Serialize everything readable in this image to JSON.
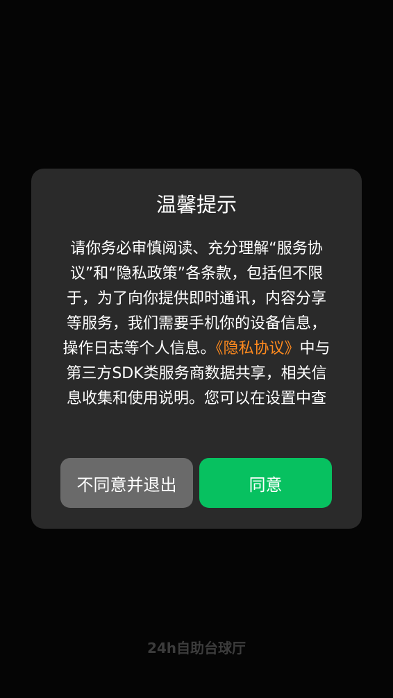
{
  "dialog": {
    "title": "温馨提示",
    "body_before_link": "请你务必审慎阅读、充分理解“服务协议”和“隐私政策”各条款，包括但不限于，为了向你提供即时通讯，内容分享等服务，我们需要手机你的设备信息，操作日志等个人信息。",
    "body_link": "《隐私协议》",
    "body_after_link": "中与第三方SDK类服务商数据共享，相关信息收集和使用说明。您可以在设置中查",
    "decline_label": "不同意并退出",
    "agree_label": "同意"
  },
  "footer": {
    "brand": "24h自助台球厅"
  },
  "colors": {
    "background": "#050505",
    "dialog": "#2a2a2a",
    "link": "#ff8a1e",
    "decline_button": "#6a6a6a",
    "agree_button": "#07c160"
  }
}
